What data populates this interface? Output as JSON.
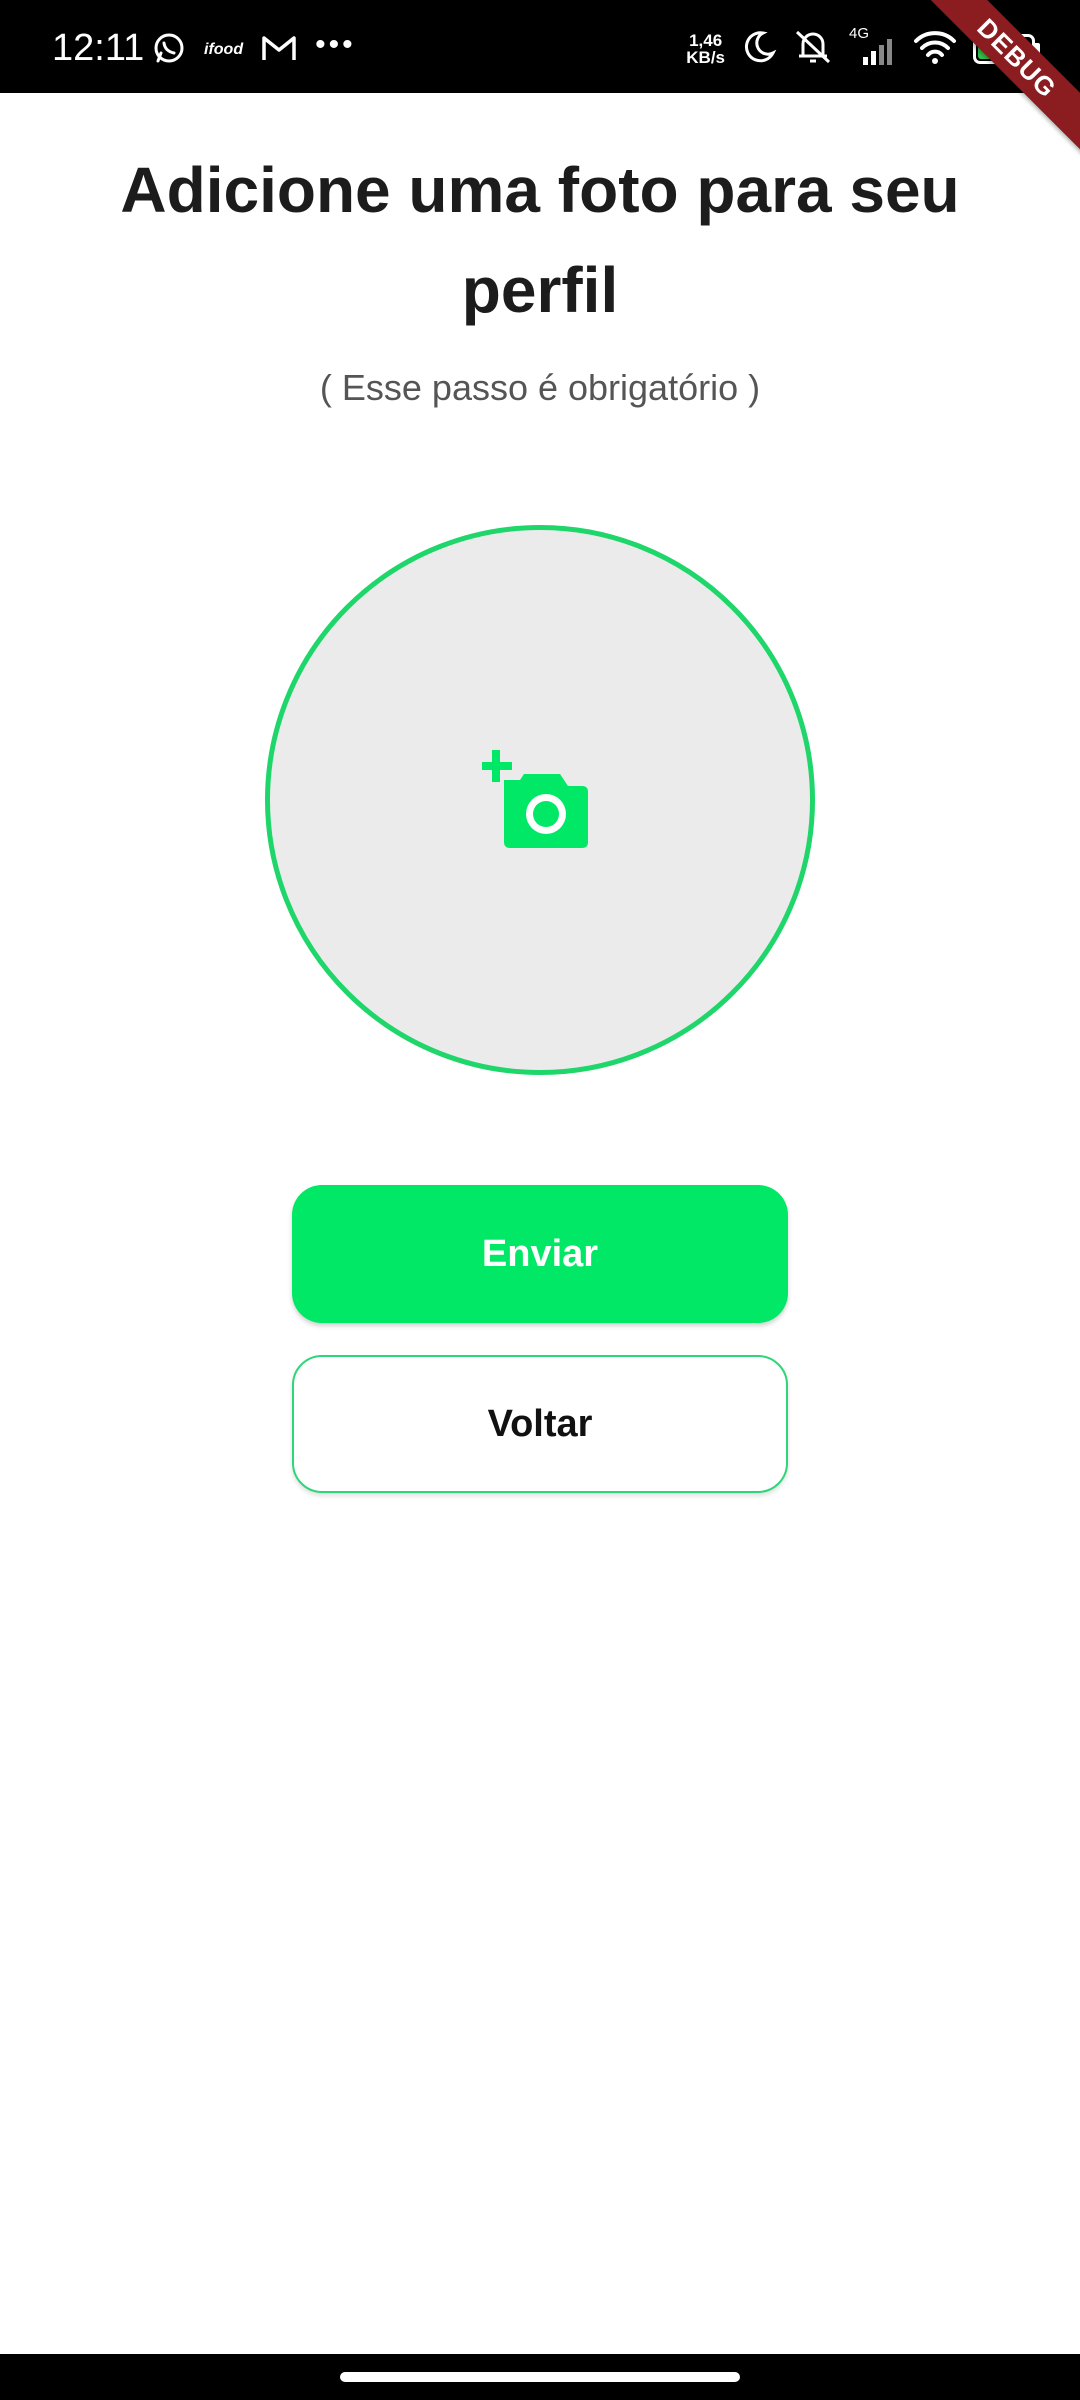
{
  "status_bar": {
    "time": "12:11",
    "left_icons": [
      "whatsapp-icon",
      "ifood-icon",
      "gmail-icon",
      "more-dots-icon"
    ],
    "ifood_label": "ifood",
    "speed_value": "1,46",
    "speed_unit": "KB/s",
    "network_type": "4G",
    "battery_level": "74",
    "battery_fraction": 0.74,
    "right_icons": [
      "moon-icon",
      "mute-bell-icon",
      "signal-icon",
      "wifi-icon",
      "battery-icon"
    ],
    "debug_label": "DEBUG"
  },
  "page": {
    "title": "Adicione uma foto para seu perfil",
    "subtitle": "( Esse passo é obrigatório )"
  },
  "photo_picker": {
    "icon": "add-photo-camera-icon"
  },
  "buttons": {
    "submit_label": "Enviar",
    "back_label": "Voltar"
  },
  "colors": {
    "accent": "#00e865",
    "accent_border": "#1ed66a",
    "picker_background": "#ebebeb",
    "title_text": "#1c1c1c",
    "subtitle_text": "#555555",
    "debug_ribbon": "#8b1c20",
    "battery_fill": "#35c24a"
  }
}
